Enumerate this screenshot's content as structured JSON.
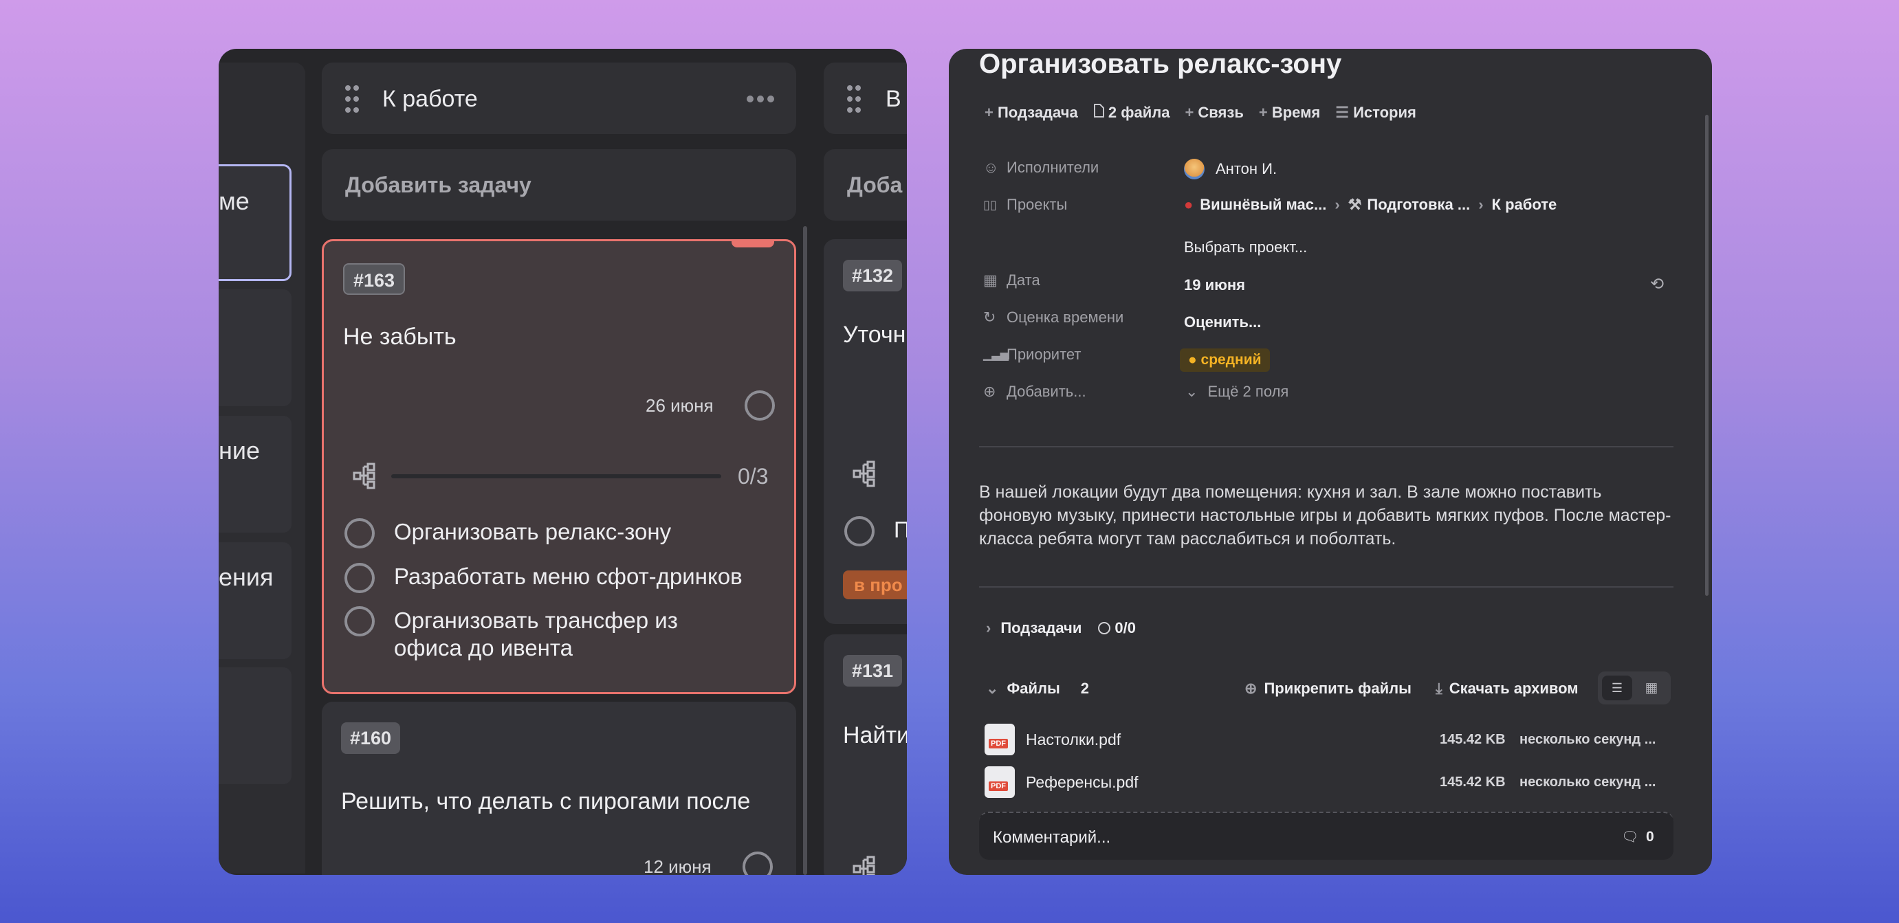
{
  "board": {
    "partial_labels": [
      "ме",
      "ние",
      "ения"
    ],
    "columns": [
      {
        "title": "К работе",
        "add_task": "Добавить задачу"
      },
      {
        "title": "В",
        "add_task": "Доба"
      }
    ],
    "cards": [
      {
        "id": "#163",
        "title": "Не забыть",
        "date": "26 июня",
        "progress": "0/3",
        "subtasks": [
          "Организовать релакс-зону",
          "Разработать меню сфот-дринков",
          "Организовать трансфер из офиса до ивента"
        ]
      },
      {
        "id": "#160",
        "title": "Решить, что делать с пирогами после",
        "date": "12 июня"
      },
      {
        "id": "#132",
        "title": "Уточн",
        "subtask_partial": "П",
        "badge": "в про"
      },
      {
        "id": "#131",
        "title": "Найти"
      }
    ]
  },
  "detail": {
    "title": "Организовать релакс-зону",
    "actions": [
      {
        "icon": "plus-icon",
        "label": "Подзадача"
      },
      {
        "icon": "file-icon",
        "label": "2 файла"
      },
      {
        "icon": "plus-icon",
        "label": "Связь"
      },
      {
        "icon": "plus-icon",
        "label": "Время"
      },
      {
        "icon": "list-icon",
        "label": "История"
      }
    ],
    "fields": {
      "assignees_label": "Исполнители",
      "assignee": "Антон И.",
      "projects_label": "Проекты",
      "project1": "Вишнёвый мас...",
      "project2": "Подготовка ...",
      "project3": "К работе",
      "choose_project": "Выбрать проект...",
      "date_label": "Дата",
      "date": "19 июня",
      "estimate_label": "Оценка времени",
      "estimate": "Оценить...",
      "priority_label": "Приоритет",
      "priority": "средний",
      "add_label": "Добавить...",
      "more_fields": "Ещё 2 поля"
    },
    "description": "В нашей локации будут два помещения: кухня и зал. В зале можно поставить фоновую музыку, принести настольные игры и добавить мягких пуфов. После мастер-класса ребята могут там расслабиться и поболтать.",
    "subtasks": {
      "label": "Подзадачи",
      "count": "0/0"
    },
    "files": {
      "label": "Файлы",
      "count": "2",
      "attach": "Прикрепить файлы",
      "download": "Скачать архивом",
      "items": [
        {
          "name": "Настолки.pdf",
          "size": "145.42 KB",
          "time": "несколько секунд ..."
        },
        {
          "name": "Референсы.pdf",
          "size": "145.42 KB",
          "time": "несколько секунд ..."
        }
      ]
    },
    "comment": {
      "placeholder": "Комментарий...",
      "count": "0"
    }
  },
  "colors": {
    "accent_card_border": "#e9736d",
    "priority_bg": "#4a3d1c",
    "priority_text": "#f5b324",
    "badge_orange": "#a0522d"
  }
}
